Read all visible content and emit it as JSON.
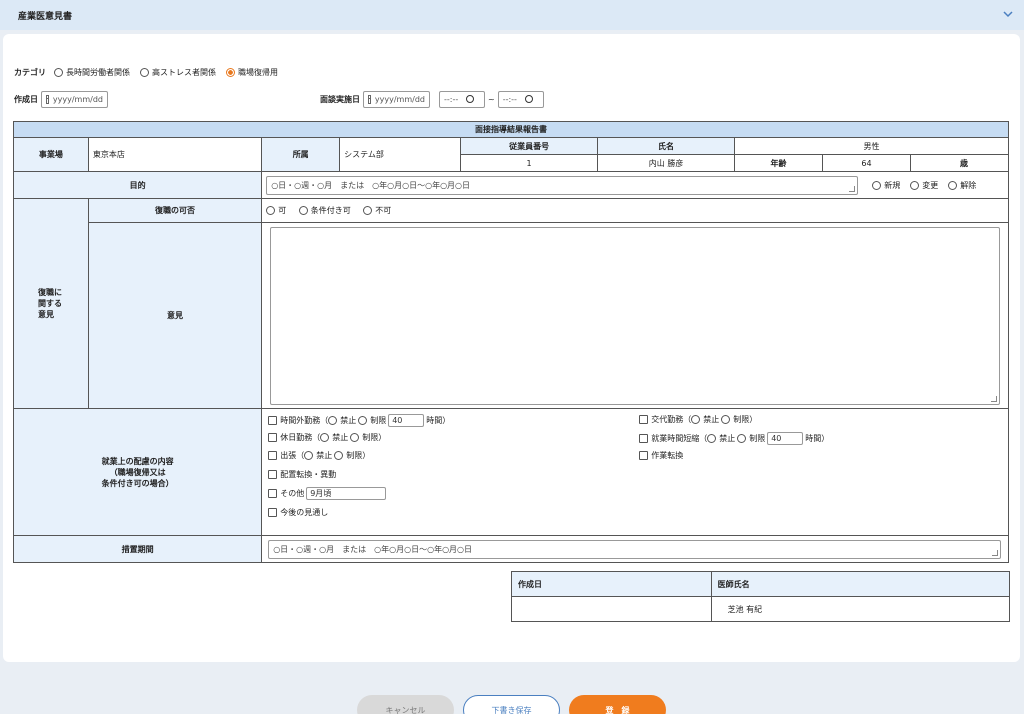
{
  "header": {
    "title": "産業医意見書"
  },
  "category": {
    "label": "カテゴリ",
    "options": [
      "長時間労働者関係",
      "高ストレス者関係",
      "職場復帰用"
    ],
    "selected": 2
  },
  "dates": {
    "created_label": "作成日",
    "created_placeholder": "yyyy/mm/dd",
    "interview_label": "面談実施日",
    "interview_placeholder": "yyyy/mm/dd",
    "time_placeholder": "--:--",
    "range_sep": "~"
  },
  "report": {
    "title": "面接指導結果報告書",
    "office_label": "事業場",
    "office_value": "東京本店",
    "dept_label": "所属",
    "dept_value": "システム部",
    "empno_label": "従業員番号",
    "empno_value": "1",
    "name_label": "氏名",
    "name_value": "内山 勝彦",
    "gender_value": "男性",
    "age_label": "年齢",
    "age_value": "64",
    "age_unit": "歳",
    "purpose_label": "目的",
    "purpose_value": "○日・○週・○月　または　○年○月○日～○年○月○日",
    "purpose_options": [
      "新規",
      "変更",
      "解除"
    ],
    "return_section_label": "復職に\n関する\n意見",
    "return_label": "復職の可否",
    "return_options": [
      "可",
      "条件付き可",
      "不可"
    ],
    "opinion_label": "意見",
    "accom_label": "就業上の配慮の内容\n（職場復帰又は\n条件付き可の場合）",
    "overtime_label": "時間外勤務（",
    "prohibit": "禁止",
    "limit": "制限",
    "overtime_hours": "40",
    "hours_unit": "時間）",
    "holiday_label": "休日勤務（",
    "close_paren": "制限）",
    "trip_label": "出張（",
    "relocation_label": "配置転換・異動",
    "other_label": "その他",
    "other_value": "9月頃",
    "outlook_label": "今後の見通し",
    "shift_label": "交代勤務（",
    "shorten_label": "就業時間短縮（",
    "shorten_hours": "40",
    "change_label": "作業転換",
    "period_label": "措置期間",
    "period_value": "○日・○週・○月　または　○年○月○日～○年○月○日"
  },
  "sign": {
    "date_label": "作成日",
    "doctor_label": "医師氏名",
    "date_value": "",
    "doctor_value": "芝池 有紀"
  },
  "footer": {
    "cancel": "キャンセル",
    "draft": "下書き保存",
    "register": "登　録"
  },
  "colors": {
    "accent": "#f07c1e",
    "header_bg": "#dce9f6",
    "table_head": "#c6dcf3"
  }
}
